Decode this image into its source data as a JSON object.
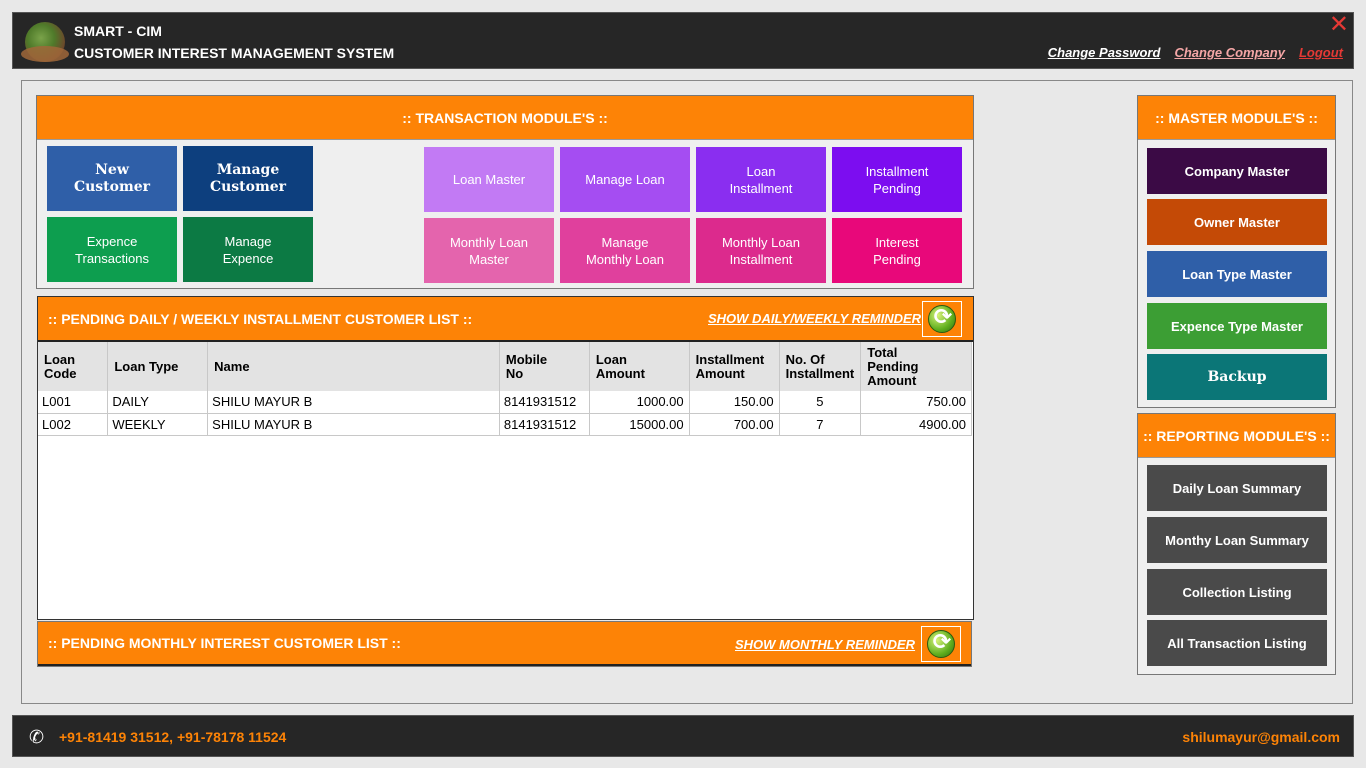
{
  "header": {
    "title": "SMART - CIM",
    "subtitle": "CUSTOMER INTEREST MANAGEMENT SYSTEM",
    "links": {
      "change_password": "Change Password",
      "change_company": "Change Company",
      "logout": "Logout"
    },
    "close_glyph": "✕"
  },
  "transaction": {
    "title": ":: TRANSACTION MODULE'S ::",
    "tiles": {
      "new_customer": "New\nCustomer",
      "manage_customer": "Manage\nCustomer",
      "expence_transactions": "Expence\nTransactions",
      "manage_expence": "Manage\nExpence",
      "loan_master": "Loan Master",
      "manage_loan": "Manage Loan",
      "loan_installment": "Loan\nInstallment",
      "installment_pending": "Installment\nPending",
      "monthly_loan_master": "Monthly Loan\nMaster",
      "manage_monthly_loan": "Manage\nMonthly Loan",
      "monthly_loan_installment": "Monthly Loan\nInstallment",
      "interest_pending": "Interest\nPending"
    }
  },
  "pending_daily": {
    "title": ":: PENDING DAILY / WEEKLY INSTALLMENT CUSTOMER LIST ::",
    "reminder_link": "SHOW DAILY/WEEKLY REMINDER",
    "columns": [
      "Loan\nCode",
      "Loan Type",
      "Name",
      "Mobile\nNo",
      "Loan\nAmount",
      "Installment\nAmount",
      "No. Of\nInstallment",
      "Total\nPending\nAmount"
    ],
    "rows": [
      [
        "L001",
        "DAILY",
        "SHILU MAYUR B",
        "8141931512",
        "1000.00",
        "150.00",
        "5",
        "750.00"
      ],
      [
        "L002",
        "WEEKLY",
        "SHILU MAYUR B",
        "8141931512",
        "15000.00",
        "700.00",
        "7",
        "4900.00"
      ]
    ]
  },
  "pending_monthly": {
    "title": ":: PENDING MONTHLY INTEREST CUSTOMER LIST ::",
    "reminder_link": "SHOW MONTHLY REMINDER"
  },
  "master": {
    "title": ":: MASTER MODULE'S ::",
    "items": [
      "Company Master",
      "Owner Master",
      "Loan Type Master",
      "Expence Type Master",
      "Backup"
    ]
  },
  "reporting": {
    "title": ":: REPORTING MODULE'S ::",
    "items": [
      "Daily Loan Summary",
      "Monthy Loan Summary",
      "Collection Listing",
      "All Transaction Listing"
    ]
  },
  "footer": {
    "phone": "+91-81419 31512, +91-78178 11524",
    "email": "shilumayur@gmail.com"
  },
  "colors": {
    "accent": "#fd8306",
    "header_bg": "#262626"
  }
}
